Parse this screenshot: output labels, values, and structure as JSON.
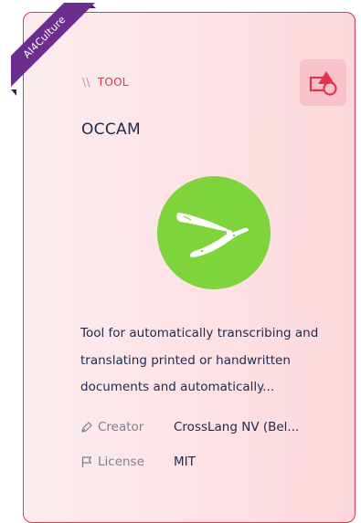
{
  "ribbon": {
    "label": "AI4Culture"
  },
  "card": {
    "type_prefix": "\\\\",
    "type_label": "TOOL",
    "type_icon": "shapes-icon",
    "title": "OCCAM",
    "logo_icon": "razor-icon",
    "description": "Tool for automatically transcribing and translating printed or handwritten documents and automatically...",
    "creator": {
      "label": "Creator",
      "value": "CrossLang NV (Bel...",
      "icon": "pen-icon"
    },
    "license": {
      "label": "License",
      "value": "MIT",
      "icon": "flag-icon"
    }
  },
  "colors": {
    "accent": "#e0344f",
    "ribbon": "#6c2d8e",
    "logo_bg": "#7ed43a",
    "text_dark": "#1d2a4d",
    "text_muted": "#7b8191",
    "card_border": "#d23c57"
  }
}
